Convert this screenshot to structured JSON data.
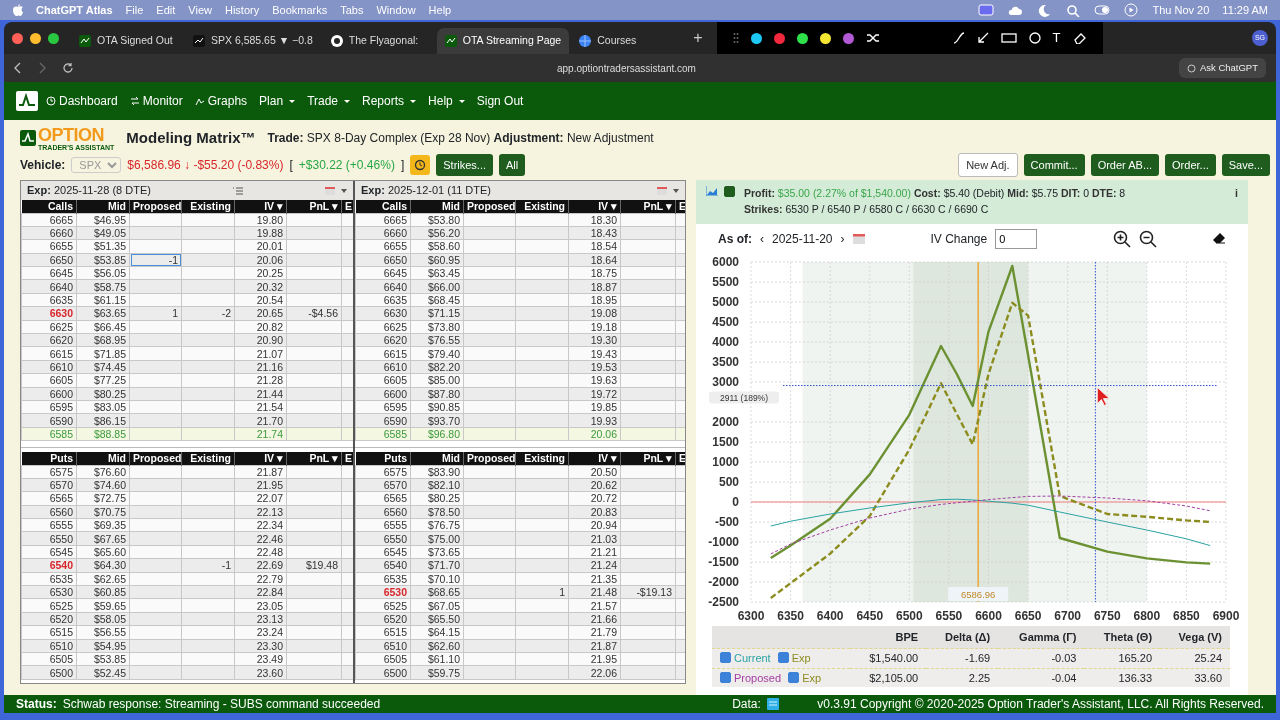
{
  "menubar": {
    "app": "ChatGPT Atlas",
    "menus": [
      "File",
      "Edit",
      "View",
      "History",
      "Bookmarks",
      "Tabs",
      "Window",
      "Help"
    ],
    "date": "Thu Nov 20",
    "time": "11:29 AM"
  },
  "browser": {
    "tabs": [
      {
        "label": "OTA Signed Out",
        "selected": false,
        "kind": "ota"
      },
      {
        "label": "SPX 6,585.65 ▼ −0.8",
        "selected": false,
        "kind": "chart"
      },
      {
        "label": "The Flyagonal:",
        "selected": false,
        "kind": "circle"
      },
      {
        "label": "OTA Streaming Page",
        "selected": true,
        "kind": "ota"
      },
      {
        "label": "Courses",
        "selected": false,
        "kind": "globe"
      }
    ],
    "new_tab": "+",
    "annotation_colors": [
      {
        "color": "#1ec8f5"
      },
      {
        "color": "#f2283c"
      },
      {
        "color": "#2ee04a"
      },
      {
        "color": "#f5e632"
      },
      {
        "color": "#b25ad6"
      }
    ],
    "text_tool": "T",
    "profile": "SG",
    "url": "app.optiontradersassistant.com",
    "ask": "Ask ChatGPT"
  },
  "navbar": {
    "items": [
      {
        "label": "Dashboard",
        "kind": "dashboard",
        "dropdown": false
      },
      {
        "label": "Monitor",
        "kind": "monitor",
        "dropdown": false
      },
      {
        "label": "Graphs",
        "kind": "graphs",
        "dropdown": false
      },
      {
        "label": "Plan",
        "kind": "plain",
        "dropdown": true
      },
      {
        "label": "Trade",
        "kind": "plain",
        "dropdown": true
      },
      {
        "label": "Reports",
        "kind": "plain",
        "dropdown": true
      },
      {
        "label": "Help",
        "kind": "plain",
        "dropdown": true
      },
      {
        "label": "Sign Out",
        "kind": "plain",
        "dropdown": false
      }
    ]
  },
  "header": {
    "logo_top": "OPTION",
    "logo_bottom": "TRADER'S ASSISTANT",
    "title": "Modeling Matrix™",
    "trade": "**Trade:** SPX 8-Day Complex (Exp 28 Nov) **Adjustment:** New Adjustment"
  },
  "vehicle": {
    "label": "Vehicle:",
    "symbol": "SPX",
    "price": "$6,586.96 ↓ -$55.20 (-0.83%)",
    "bracket_open": "[",
    "gain": "+$30.22 (+0.46%)",
    "bracket_close": "]",
    "buttons": [
      "Strikes...",
      "All"
    ],
    "actions": [
      {
        "label": "New Adj.",
        "kind": "outline"
      },
      {
        "label": "Commit...",
        "kind": "solid"
      },
      {
        "label": "Order AB...",
        "kind": "solid"
      },
      {
        "label": "Order...",
        "kind": "solid"
      },
      {
        "label": "Save...",
        "kind": "solid"
      }
    ]
  },
  "matrix": [
    {
      "exp": "**Exp:** 2025-11-28 (8 DTE)",
      "list_toggle": true,
      "calls": {
        "columns": [
          "Calls",
          "Mid",
          "Proposed",
          "Existing",
          "IV ▾",
          "PnL ▾",
          "E"
        ],
        "rows": [
          {
            "strike": "6665",
            "mid": "$46.95",
            "iv": "19.80",
            "kind": "plain"
          },
          {
            "strike": "6660",
            "mid": "$49.05",
            "iv": "19.88",
            "kind": "plain"
          },
          {
            "strike": "6655",
            "mid": "$51.35",
            "iv": "20.01",
            "kind": "plain"
          },
          {
            "strike": "6650",
            "mid": "$53.85",
            "proposed": "-1",
            "iv": "20.06",
            "kind": "plain",
            "editing": true
          },
          {
            "strike": "6645",
            "mid": "$56.05",
            "iv": "20.25",
            "kind": "plain"
          },
          {
            "strike": "6640",
            "mid": "$58.75",
            "iv": "20.32",
            "kind": "plain"
          },
          {
            "strike": "6635",
            "mid": "$61.15",
            "iv": "20.54",
            "kind": "plain"
          },
          {
            "strike": "6630",
            "mid": "$63.65",
            "proposed": "1",
            "existing": "-2",
            "iv": "20.65",
            "pnl": "-$4.56",
            "kind": "position"
          },
          {
            "strike": "6625",
            "mid": "$66.45",
            "iv": "20.82",
            "kind": "plain"
          },
          {
            "strike": "6620",
            "mid": "$68.95",
            "iv": "20.90",
            "kind": "plain"
          },
          {
            "strike": "6615",
            "mid": "$71.85",
            "iv": "21.07",
            "kind": "plain"
          },
          {
            "strike": "6610",
            "mid": "$74.45",
            "iv": "21.16",
            "kind": "plain"
          },
          {
            "strike": "6605",
            "mid": "$77.25",
            "iv": "21.28",
            "kind": "plain"
          },
          {
            "strike": "6600",
            "mid": "$80.25",
            "iv": "21.44",
            "kind": "plain"
          },
          {
            "strike": "6595",
            "mid": "$83.05",
            "iv": "21.54",
            "kind": "plain"
          },
          {
            "strike": "6590",
            "mid": "$86.15",
            "iv": "21.70",
            "kind": "plain"
          },
          {
            "strike": "6585",
            "mid": "$88.85",
            "iv": "21.74",
            "kind": "atm"
          }
        ]
      },
      "puts": {
        "columns": [
          "Puts",
          "Mid",
          "Proposed",
          "Existing",
          "IV ▾",
          "PnL ▾",
          "E"
        ],
        "rows": [
          {
            "strike": "6575",
            "mid": "$76.60",
            "iv": "21.87",
            "kind": "plain"
          },
          {
            "strike": "6570",
            "mid": "$74.60",
            "iv": "21.95",
            "kind": "plain"
          },
          {
            "strike": "6565",
            "mid": "$72.75",
            "iv": "22.07",
            "kind": "plain"
          },
          {
            "strike": "6560",
            "mid": "$70.75",
            "iv": "22.13",
            "kind": "plain"
          },
          {
            "strike": "6555",
            "mid": "$69.35",
            "iv": "22.34",
            "kind": "plain"
          },
          {
            "strike": "6550",
            "mid": "$67.65",
            "iv": "22.46",
            "kind": "plain"
          },
          {
            "strike": "6545",
            "mid": "$65.60",
            "iv": "22.48",
            "kind": "plain"
          },
          {
            "strike": "6540",
            "mid": "$64.30",
            "existing": "-1",
            "iv": "22.69",
            "pnl": "$19.48",
            "kind": "position"
          },
          {
            "strike": "6535",
            "mid": "$62.65",
            "iv": "22.79",
            "kind": "plain"
          },
          {
            "strike": "6530",
            "mid": "$60.85",
            "iv": "22.84",
            "kind": "plain"
          },
          {
            "strike": "6525",
            "mid": "$59.65",
            "iv": "23.05",
            "kind": "plain"
          },
          {
            "strike": "6520",
            "mid": "$58.05",
            "iv": "23.13",
            "kind": "plain"
          },
          {
            "strike": "6515",
            "mid": "$56.55",
            "iv": "23.24",
            "kind": "plain"
          },
          {
            "strike": "6510",
            "mid": "$54.95",
            "iv": "23.30",
            "kind": "plain"
          },
          {
            "strike": "6505",
            "mid": "$53.85",
            "iv": "23.49",
            "kind": "plain"
          },
          {
            "strike": "6500",
            "mid": "$52.45",
            "iv": "23.60",
            "kind": "plain"
          }
        ]
      }
    },
    {
      "exp": "**Exp:** 2025-12-01 (11 DTE)",
      "list_toggle": false,
      "calls": {
        "columns": [
          "Calls",
          "Mid",
          "Proposed",
          "Existing",
          "IV ▾",
          "PnL ▾",
          "E"
        ],
        "rows": [
          {
            "strike": "6665",
            "mid": "$53.80",
            "iv": "18.30",
            "kind": "plain"
          },
          {
            "strike": "6660",
            "mid": "$56.20",
            "iv": "18.43",
            "kind": "plain"
          },
          {
            "strike": "6655",
            "mid": "$58.60",
            "iv": "18.54",
            "kind": "plain"
          },
          {
            "strike": "6650",
            "mid": "$60.95",
            "iv": "18.64",
            "kind": "plain"
          },
          {
            "strike": "6645",
            "mid": "$63.45",
            "iv": "18.75",
            "kind": "plain"
          },
          {
            "strike": "6640",
            "mid": "$66.00",
            "iv": "18.87",
            "kind": "plain"
          },
          {
            "strike": "6635",
            "mid": "$68.45",
            "iv": "18.95",
            "kind": "plain"
          },
          {
            "strike": "6630",
            "mid": "$71.15",
            "iv": "19.08",
            "kind": "plain"
          },
          {
            "strike": "6625",
            "mid": "$73.80",
            "iv": "19.18",
            "kind": "plain"
          },
          {
            "strike": "6620",
            "mid": "$76.55",
            "iv": "19.30",
            "kind": "plain"
          },
          {
            "strike": "6615",
            "mid": "$79.40",
            "iv": "19.43",
            "kind": "plain"
          },
          {
            "strike": "6610",
            "mid": "$82.20",
            "iv": "19.53",
            "kind": "plain"
          },
          {
            "strike": "6605",
            "mid": "$85.00",
            "iv": "19.63",
            "kind": "plain"
          },
          {
            "strike": "6600",
            "mid": "$87.80",
            "iv": "19.72",
            "kind": "plain"
          },
          {
            "strike": "6595",
            "mid": "$90.85",
            "iv": "19.85",
            "kind": "plain"
          },
          {
            "strike": "6590",
            "mid": "$93.70",
            "iv": "19.93",
            "kind": "plain"
          },
          {
            "strike": "6585",
            "mid": "$96.80",
            "iv": "20.06",
            "kind": "atm"
          }
        ]
      },
      "puts": {
        "columns": [
          "Puts",
          "Mid",
          "Proposed",
          "Existing",
          "IV ▾",
          "PnL ▾",
          "E"
        ],
        "rows": [
          {
            "strike": "6575",
            "mid": "$83.90",
            "iv": "20.50",
            "kind": "plain"
          },
          {
            "strike": "6570",
            "mid": "$82.10",
            "iv": "20.62",
            "kind": "plain"
          },
          {
            "strike": "6565",
            "mid": "$80.25",
            "iv": "20.72",
            "kind": "plain"
          },
          {
            "strike": "6560",
            "mid": "$78.50",
            "iv": "20.83",
            "kind": "plain"
          },
          {
            "strike": "6555",
            "mid": "$76.75",
            "iv": "20.94",
            "kind": "plain"
          },
          {
            "strike": "6550",
            "mid": "$75.00",
            "iv": "21.03",
            "kind": "plain"
          },
          {
            "strike": "6545",
            "mid": "$73.65",
            "iv": "21.21",
            "kind": "plain"
          },
          {
            "strike": "6540",
            "mid": "$71.70",
            "iv": "21.24",
            "kind": "plain"
          },
          {
            "strike": "6535",
            "mid": "$70.10",
            "iv": "21.35",
            "kind": "plain"
          },
          {
            "strike": "6530",
            "mid": "$68.65",
            "existing": "1",
            "iv": "21.48",
            "pnl": "-$19.13",
            "kind": "position"
          },
          {
            "strike": "6525",
            "mid": "$67.05",
            "iv": "21.57",
            "kind": "plain"
          },
          {
            "strike": "6520",
            "mid": "$65.50",
            "iv": "21.66",
            "kind": "plain"
          },
          {
            "strike": "6515",
            "mid": "$64.15",
            "iv": "21.79",
            "kind": "plain"
          },
          {
            "strike": "6510",
            "mid": "$62.60",
            "iv": "21.87",
            "kind": "plain"
          },
          {
            "strike": "6505",
            "mid": "$61.10",
            "iv": "21.95",
            "kind": "plain"
          },
          {
            "strike": "6500",
            "mid": "$59.75",
            "iv": "22.06",
            "kind": "plain"
          }
        ]
      }
    }
  ],
  "chart_panel": {
    "show_checked": true,
    "summary": [
      {
        "label": "Profit:",
        "value": "$35.00 (2.27% of $1,540.00)",
        "kind": "gain"
      },
      {
        "label": "Cost:",
        "value": "$5.40 (Debit)",
        "kind": "plain"
      },
      {
        "label": "Mid:",
        "value": "$5.75",
        "kind": "plain"
      },
      {
        "label": "DIT:",
        "value": "0",
        "kind": "plain"
      },
      {
        "label": "DTE:",
        "value": "8",
        "kind": "plain"
      }
    ],
    "strikes": "**Strikes:** 6530 P / 6540 P / 6580 C / 6630 C / 6690 C",
    "info": "i",
    "as_of_label": "As of:",
    "prev": "‹",
    "date": "2025-11-20",
    "next": "›",
    "iv_label": "IV Change",
    "iv_value": "0",
    "chart_data": {
      "type": "line",
      "xlim": [
        6300,
        6900
      ],
      "ylim": [
        -2500,
        6000
      ],
      "xticks": [
        6300,
        6350,
        6400,
        6450,
        6500,
        6550,
        6600,
        6650,
        6700,
        6750,
        6800,
        6850,
        6900
      ],
      "yticks": [
        -2500,
        -2000,
        -1500,
        -1000,
        -500,
        0,
        500,
        1000,
        1500,
        2000,
        3000,
        3500,
        4000,
        4500,
        5000,
        5500,
        6000
      ],
      "x": [
        6325,
        6350,
        6400,
        6450,
        6500,
        6540,
        6560,
        6580,
        6600,
        6630,
        6650,
        6690,
        6750,
        6800,
        6850,
        6880
      ],
      "grid": true,
      "series": [
        {
          "color": "#6b9132",
          "line_style": "solid",
          "values": [
            -1400,
            -1090,
            -420,
            690,
            2180,
            3900,
            3200,
            2400,
            4260,
            5900,
            3670,
            -900,
            -1240,
            -1410,
            -1510,
            -1540
          ]
        },
        {
          "color": "#8c8c1e",
          "line_style": "dashed",
          "values": [
            -2400,
            -2030,
            -1290,
            -350,
            1310,
            2970,
            2200,
            1440,
            3200,
            4980,
            4660,
            150,
            -300,
            -370,
            -460,
            -500
          ]
        },
        {
          "color": "#2aa3a3",
          "line_style": "solid",
          "values": [
            -600,
            -480,
            -300,
            -150,
            -20,
            60,
            70,
            50,
            20,
            -30,
            -80,
            -250,
            -500,
            -700,
            -920,
            -1090
          ]
        },
        {
          "color": "#a33fa3",
          "line_style": "dashed",
          "values": [
            -1300,
            -1050,
            -700,
            -400,
            -180,
            -60,
            -20,
            20,
            60,
            110,
            140,
            150,
            100,
            30,
            -100,
            -220
          ]
        }
      ],
      "bands": [
        {
          "axis": "x",
          "from": 6365,
          "to": 6800
        },
        {
          "axis": "x",
          "from": 6505,
          "to": 6650
        }
      ],
      "ref_lines": [
        {
          "axis": "y",
          "value": 0,
          "color": "#f08080"
        },
        {
          "axis": "x",
          "value": 6586.96,
          "label": "6586.96",
          "color": "#f0a020"
        },
        {
          "axis": "x",
          "value": 6735,
          "color": "#3050d0"
        },
        {
          "axis": "y",
          "value": 2911,
          "label": "2911 (189%)",
          "color": "#3050d0"
        }
      ]
    }
  },
  "greeks": {
    "columns": [
      "BPE",
      "Delta (Δ)",
      "Gamma (Γ)",
      "Theta (Θ)",
      "Vega (V)"
    ],
    "rows": [
      {
        "label": "Current",
        "checked": true,
        "exp_label": "Exp",
        "exp_checked": true,
        "color": "#2aa3a3",
        "values": [
          "$1,540.00",
          "-1.69",
          "-0.03",
          "165.20",
          "25.24"
        ]
      },
      {
        "label": "Proposed",
        "checked": true,
        "exp_label": "Exp",
        "exp_checked": true,
        "color": "#a33fa3",
        "values": [
          "$2,105.00",
          "2.25",
          "-0.04",
          "136.33",
          "33.60"
        ]
      }
    ]
  },
  "status": {
    "label": "Status:",
    "text": "Schwab response: Streaming - SUBS command succeeded",
    "data_label": "Data:",
    "copyright": "v0.3.91 Copyright © 2020-2025 Option Trader's Assistant, LLC. All Rights Reserved."
  }
}
